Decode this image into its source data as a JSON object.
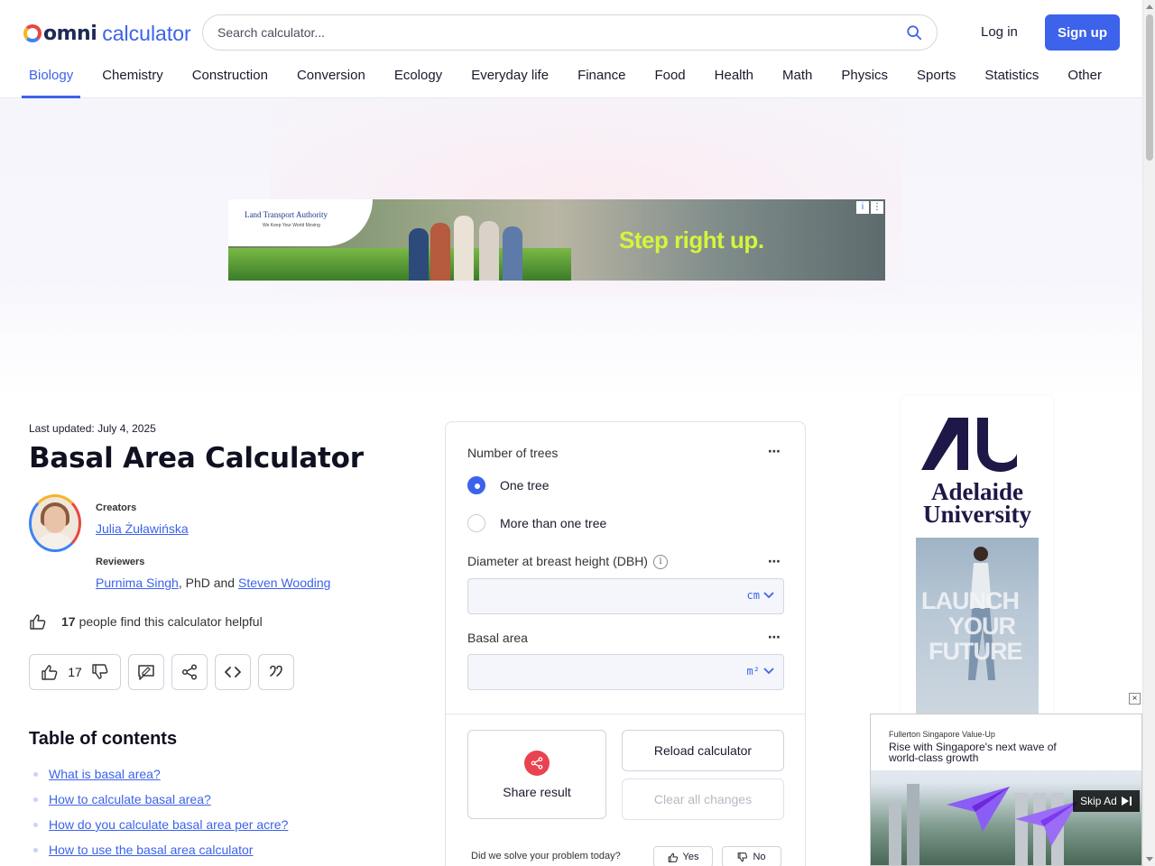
{
  "header": {
    "logo_omni": "omni",
    "logo_calculator": "calculator",
    "search_placeholder": "Search calculator...",
    "login": "Log in",
    "signup": "Sign up"
  },
  "nav": {
    "items": [
      "Biology",
      "Chemistry",
      "Construction",
      "Conversion",
      "Ecology",
      "Everyday life",
      "Finance",
      "Food",
      "Health",
      "Math",
      "Physics",
      "Sports",
      "Statistics",
      "Other"
    ],
    "active": "Biology"
  },
  "ad_banner": {
    "brand": "Land Transport Authority",
    "tagline_small": "We Keep Your World Moving",
    "headline": "Step right up.",
    "info_icon": "info-icon",
    "menu_icon": "kebab-icon"
  },
  "article": {
    "last_updated_label": "Last updated:",
    "last_updated_date": "July 4, 2025",
    "title": "Basal Area Calculator",
    "creators_label": "Creators",
    "creator": "Julia Żuławińska",
    "reviewers_label": "Reviewers",
    "reviewer_1": "Purnima Singh",
    "reviewer_sep": ", PhD and ",
    "reviewer_2": "Steven Wooding",
    "helpful_count": "17",
    "helpful_text": "people find this calculator helpful",
    "vote_count": "17"
  },
  "toc": {
    "title": "Table of contents",
    "items": [
      "What is basal area?",
      "How to calculate basal area?",
      "How do you calculate basal area per acre?",
      "How to use the basal area calculator"
    ]
  },
  "calculator": {
    "number_of_trees_label": "Number of trees",
    "option_one": "One tree",
    "option_many": "More than one tree",
    "selected_option": "One tree",
    "dbh_label": "Diameter at breast height (DBH)",
    "dbh_value": "",
    "dbh_unit": "cm",
    "basal_area_label": "Basal area",
    "basal_area_value": "",
    "basal_area_unit": "m²",
    "more_icon": "⋯",
    "share_label": "Share result",
    "reload_label": "Reload calculator",
    "clear_label": "Clear all changes",
    "solve_question": "Did we solve your problem today?",
    "yes_label": "Yes",
    "no_label": "No"
  },
  "sky_ad": {
    "name_line1": "Adelaide",
    "name_line2": "University",
    "slogan_line1": "LAUNCH",
    "slogan_line2": "YOUR",
    "slogan_line3": "FUTURE"
  },
  "video_ad": {
    "small": "Fullerton Singapore Value-Up",
    "headline": "Rise with Singapore's next wave of world-class growth",
    "skip": "Skip Ad",
    "close": "×"
  }
}
